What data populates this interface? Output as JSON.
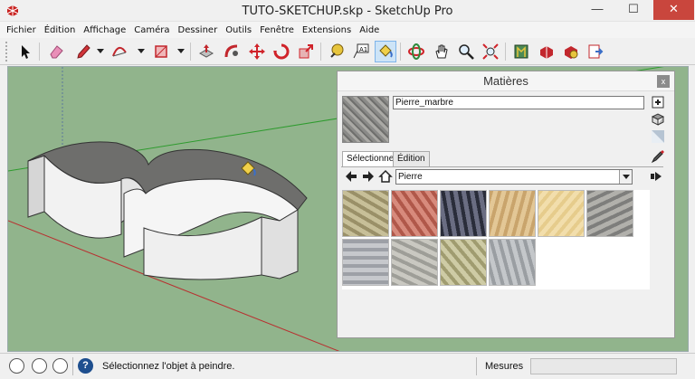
{
  "window": {
    "title": "TUTO-SKETCHUP.skp - SketchUp Pro",
    "minimize": "—",
    "maximize": "☐",
    "close": "✕"
  },
  "menu": [
    "Fichier",
    "Édition",
    "Affichage",
    "Caméra",
    "Dessiner",
    "Outils",
    "Fenêtre",
    "Extensions",
    "Aide"
  ],
  "toolbar_icons": [
    "select-icon",
    "eraser-icon",
    "pencil-icon",
    "arc-icon",
    "rectangle-icon",
    "push-pull-icon",
    "follow-me-icon",
    "move-icon",
    "rotate-icon",
    "scale-icon",
    "tape-measure-icon",
    "text-icon",
    "paint-bucket-icon",
    "orbit-icon",
    "pan-icon",
    "zoom-icon",
    "zoom-extents-icon",
    "warehouse-icon",
    "get-models-icon",
    "extension-warehouse-icon",
    "share-model-icon"
  ],
  "materials_panel": {
    "title": "Matières",
    "close": "x",
    "material_name": "Pierre_marbre",
    "tabs": [
      "Sélectionner",
      "Édition"
    ],
    "library": "Pierre",
    "swatches": [
      {
        "name": "stone-wall",
        "color_a": "#9a9068",
        "color_b": "#c7bf98"
      },
      {
        "name": "red-brick",
        "color_a": "#b0584a",
        "color_b": "#d78a7c"
      },
      {
        "name": "granite-dark",
        "color_a": "#2a2d3a",
        "color_b": "#6a6d82"
      },
      {
        "name": "sandstone-blocks",
        "color_a": "#c9a46c",
        "color_b": "#e3c796"
      },
      {
        "name": "sand-tile",
        "color_a": "#e6cc8c",
        "color_b": "#f2deac"
      },
      {
        "name": "grey-marble",
        "color_a": "#7e7e7c",
        "color_b": "#b1b0ab"
      },
      {
        "name": "grey-marble-light",
        "color_a": "#9da0a6",
        "color_b": "#c6c8cc"
      },
      {
        "name": "flagstone-grey",
        "color_a": "#9e9e98",
        "color_b": "#c9c8c1"
      },
      {
        "name": "flagstone-olive",
        "color_a": "#a09c70",
        "color_b": "#cecba5"
      },
      {
        "name": "slate-grey",
        "color_a": "#9a9ea2",
        "color_b": "#c4c7ca"
      }
    ]
  },
  "status": {
    "message": "Sélectionnez l'objet à peindre.",
    "mesures_label": "Mesures",
    "mesures_value": ""
  },
  "colors": {
    "viewport": "#91b48c",
    "stone_top": "#6e6e6c",
    "wall": "#f2f2f2"
  }
}
